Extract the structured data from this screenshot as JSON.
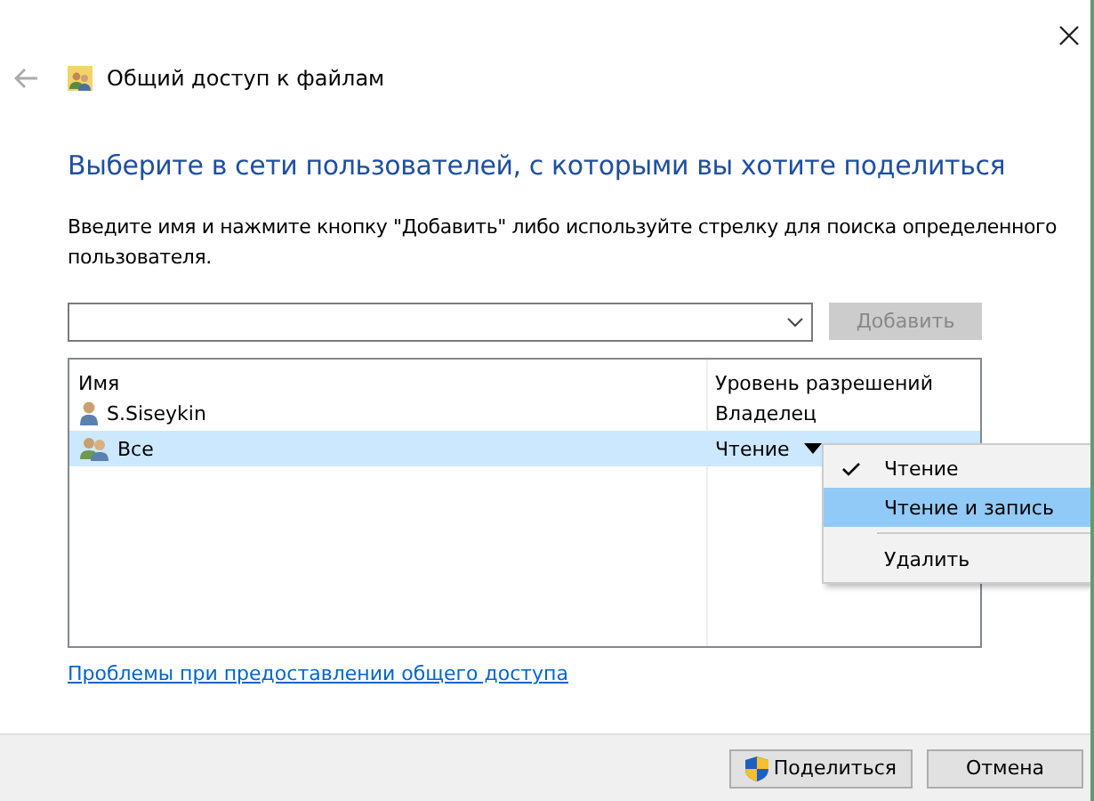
{
  "window": {
    "title": "Общий доступ к файлам"
  },
  "heading": "Выберите в сети пользователей, с которыми вы хотите поделиться",
  "instruction": "Введите имя и нажмите кнопку \"Добавить\" либо используйте стрелку для поиска определенного пользователя.",
  "add_button": {
    "label": "Добавить",
    "disabled": true
  },
  "table": {
    "columns": [
      "Имя",
      "Уровень разрешений"
    ],
    "rows": [
      {
        "name": "S.Siseykin",
        "permission": "Владелец",
        "kind": "user",
        "selected": false,
        "has_dropdown": false
      },
      {
        "name": "Все",
        "permission": "Чтение",
        "kind": "group",
        "selected": true,
        "has_dropdown": true
      }
    ]
  },
  "menu": {
    "items": [
      {
        "label": "Чтение",
        "kind": "option",
        "checked": true,
        "selected": false
      },
      {
        "label": "Чтение и запись",
        "kind": "option",
        "checked": false,
        "selected": true
      },
      {
        "label": "Удалить",
        "kind": "action",
        "checked": false,
        "selected": false
      }
    ]
  },
  "link": "Проблемы при предоставлении общего доступа",
  "buttons": [
    {
      "label": "Поделиться",
      "kind": "elevated"
    },
    {
      "label": "Отмена",
      "kind": "plain"
    }
  ]
}
